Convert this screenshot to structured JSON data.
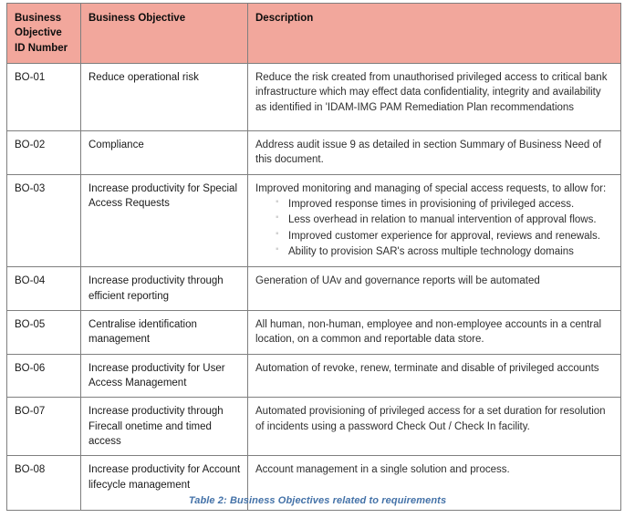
{
  "document": {
    "caption": "Table 2: Business Objectives related to requirements",
    "caption_color": "#4472a8",
    "header_bg_color": "#F2A79C",
    "border_color": "#7f7f7f"
  },
  "table": {
    "columns": [
      {
        "key": "id",
        "label": "Business Objective ID Number"
      },
      {
        "key": "objective",
        "label": "Business Objective"
      },
      {
        "key": "description",
        "label": "Description"
      }
    ],
    "rows": [
      {
        "id": "BO-01",
        "objective": "Reduce operational risk",
        "description": "Reduce the risk created from unauthorised privileged access to critical bank infrastructure which may effect data confidentiality, integrity and availability as identified in 'IDAM-IMG PAM Remediation Plan recommendations",
        "bullets": []
      },
      {
        "id": "BO-02",
        "objective": "Compliance",
        "description": "Address audit issue 9 as detailed in section Summary of Business Need of this document.",
        "bullets": []
      },
      {
        "id": "BO-03",
        "objective": "Increase productivity for Special Access Requests",
        "description": "Improved monitoring and managing of special access requests, to allow for:",
        "bullets": [
          "Improved response times in provisioning of privileged access.",
          "Less overhead in relation to manual intervention of approval flows.",
          "Improved customer experience for approval, reviews and renewals.",
          "Ability to provision SAR's across multiple technology domains"
        ]
      },
      {
        "id": "BO-04",
        "objective": "Increase productivity  through efficient reporting",
        "description": "Generation of UAv and governance reports will be automated",
        "bullets": []
      },
      {
        "id": "BO-05",
        "objective": "Centralise identification management",
        "description": "All human, non-human, employee and non-employee accounts in a central location, on a common and reportable data store.",
        "bullets": []
      },
      {
        "id": "BO-06",
        "objective": "Increase productivity for User Access Management",
        "description": "Automation of revoke, renew, terminate and disable of privileged accounts",
        "bullets": []
      },
      {
        "id": "BO-07",
        "objective": "Increase productivity through Firecall onetime and timed access",
        "description": "Automated provisioning of privileged access for a set duration for resolution of incidents using a password Check Out / Check In facility.",
        "bullets": []
      },
      {
        "id": "BO-08",
        "objective": "Increase productivity for Account lifecycle management",
        "description": "Account management in a single solution and process.",
        "bullets": []
      }
    ]
  }
}
